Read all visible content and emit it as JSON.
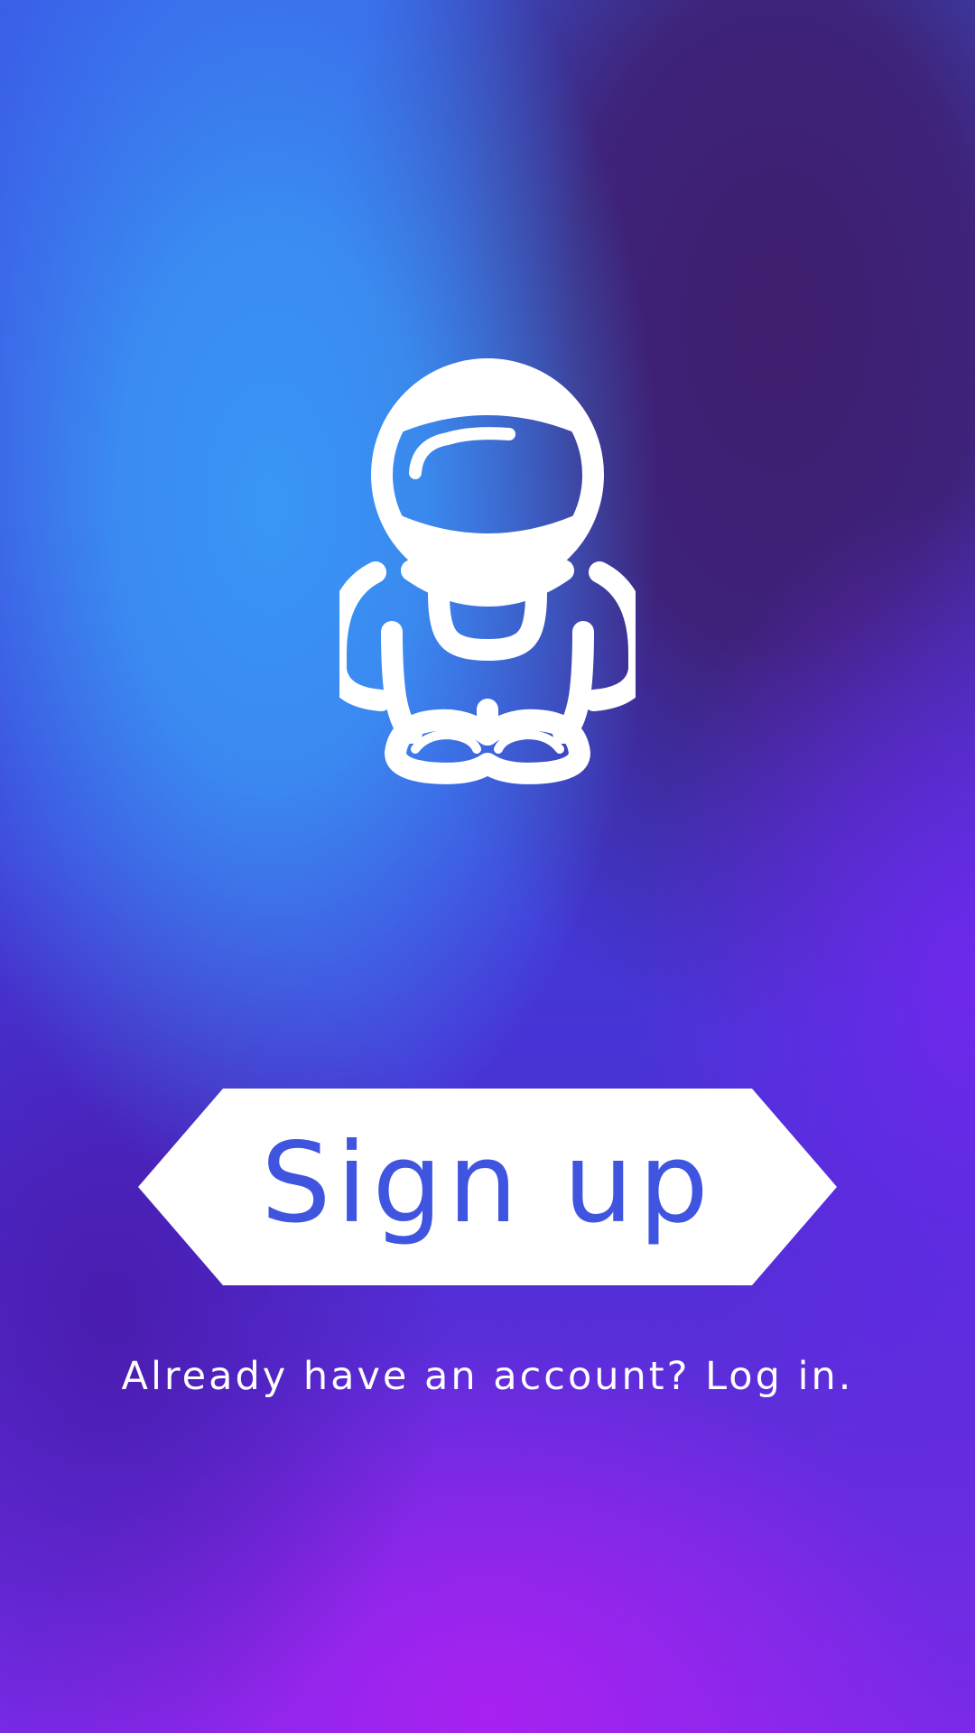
{
  "screen": {
    "name": "welcome-signup"
  },
  "mascot": {
    "icon": "astronaut-icon"
  },
  "signup_button": {
    "label": "Sign up",
    "fill_color": "#ffffff",
    "text_color": "#3f55e0"
  },
  "login_prompt": {
    "question": "Already have an account?",
    "link": "Log in."
  },
  "colors": {
    "blue": "#3a96f5",
    "dark_purple": "#3e1e6e",
    "violet": "#6a28e8",
    "magenta": "#a822f0",
    "text": "#ffffff"
  }
}
